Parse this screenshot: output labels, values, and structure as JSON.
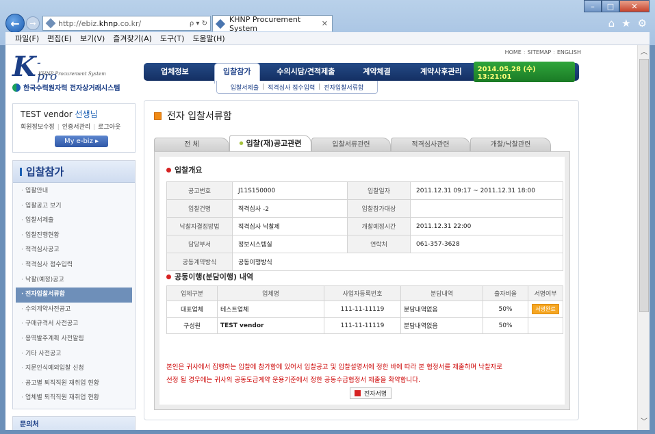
{
  "browser": {
    "url_prefix": "http://ebiz.",
    "url_host": "khnp",
    "url_suffix": ".co.kr/",
    "url_actions": "ρ ▾ ↻",
    "tab_title": "KHNP Procurement System",
    "menu": [
      "파일(F)",
      "편집(E)",
      "보기(V)",
      "즐겨찾기(A)",
      "도구(T)",
      "도움말(H)"
    ]
  },
  "header": {
    "logo_k": "K",
    "logo_pro": "-pro",
    "logo_sub": "KHNP Procurement System",
    "logo_corp": "한국수력원자력 전자상거래시스템",
    "toplinks": [
      "HOME",
      "SITEMAP",
      "ENGLISH"
    ],
    "gnb": [
      "업체정보",
      "입찰참가",
      "수의시담/견적제출",
      "계약체결",
      "계약사후관리"
    ],
    "clock": "2014.05.28 (수)  13:21:01",
    "subnav": [
      "입찰서제출",
      "적격심사 점수입력",
      "전자입찰서류함"
    ]
  },
  "user": {
    "name": "TEST vendor",
    "honorific": "선생님",
    "links": [
      "회원정보수정",
      "인증서관리",
      "로그아웃"
    ],
    "my_ebiz": "My e-biz"
  },
  "lnb": {
    "title": "입찰참가",
    "items": [
      "입찰안내",
      "입찰공고 보기",
      "입찰서제출",
      "입찰진행현황",
      "적격심사공고",
      "적격심사 점수입력",
      "낙찰(예정)공고",
      "전자입찰서류함",
      "수의계약사전공고",
      "구매규격서 사전공고",
      "용역발주계획 사전알림",
      "기타 사전공고",
      "지문인식예외입찰 신청",
      "공고별 퇴직직원 재취업 현황",
      "업체별 퇴직직원 재취업 현황"
    ],
    "active_index": 7,
    "contact": "문의처"
  },
  "main": {
    "title": "전자 입찰서류함",
    "tabs": [
      "전   체",
      "입찰(재)공고관련",
      "입찰서류관련",
      "적격심사관련",
      "개찰/낙찰관련"
    ],
    "section1": "입찰개요",
    "info": {
      "notice_no_label": "공고번호",
      "notice_no": "J11S150000",
      "bid_date_label": "입찰일자",
      "bid_date": "2011.12.31 09:17 ~ 2011.12.31 18:00",
      "bid_name_label": "입찰건명",
      "bid_name": "적격심사 -2",
      "target_label": "입찰참가대상",
      "target": "",
      "method_label": "낙찰자결정방법",
      "method": "적격심사 낙찰제",
      "open_label": "개찰예정시간",
      "open_time": "2011.12.31 22:00",
      "dept_label": "담당부서",
      "dept": "정보시스템실",
      "contact_label": "연락처",
      "contact": "061-357-3628",
      "joint_label": "공동계약방식",
      "joint_method": "공동이행방식"
    },
    "section2": "공동이행(분담이행) 내역",
    "joint_headers": [
      "업체구분",
      "업체명",
      "사업자등록번호",
      "분담내역",
      "출자비율",
      "서명여부"
    ],
    "joint_rows": [
      {
        "type": "대표업체",
        "name": "테스트업체",
        "biz_no": "111-11-11119",
        "share": "분담내역없음",
        "ratio": "50%",
        "sign": "서명완료"
      },
      {
        "type": "구성원",
        "name": "TEST vendor",
        "biz_no": "111-11-11119",
        "share": "분담내역없음",
        "ratio": "50%",
        "sign": ""
      }
    ],
    "notice_line1": "본인은 귀사에서 집행하는 입찰에 참가함에 있어서 입찰공고 및 입찰설명서에 정한 바에 따라 본 협정서를 제출하며 낙찰자로",
    "notice_line2": "선정 될 경우에는 귀사의 공동도급계약 운용기준에서 정한 공동수급협정서 제출을 확약합니다.",
    "sign_button": "전자서명"
  },
  "colors": {
    "brand": "#1b3e86",
    "accent": "#f08a14",
    "notice": "#cc0000"
  }
}
